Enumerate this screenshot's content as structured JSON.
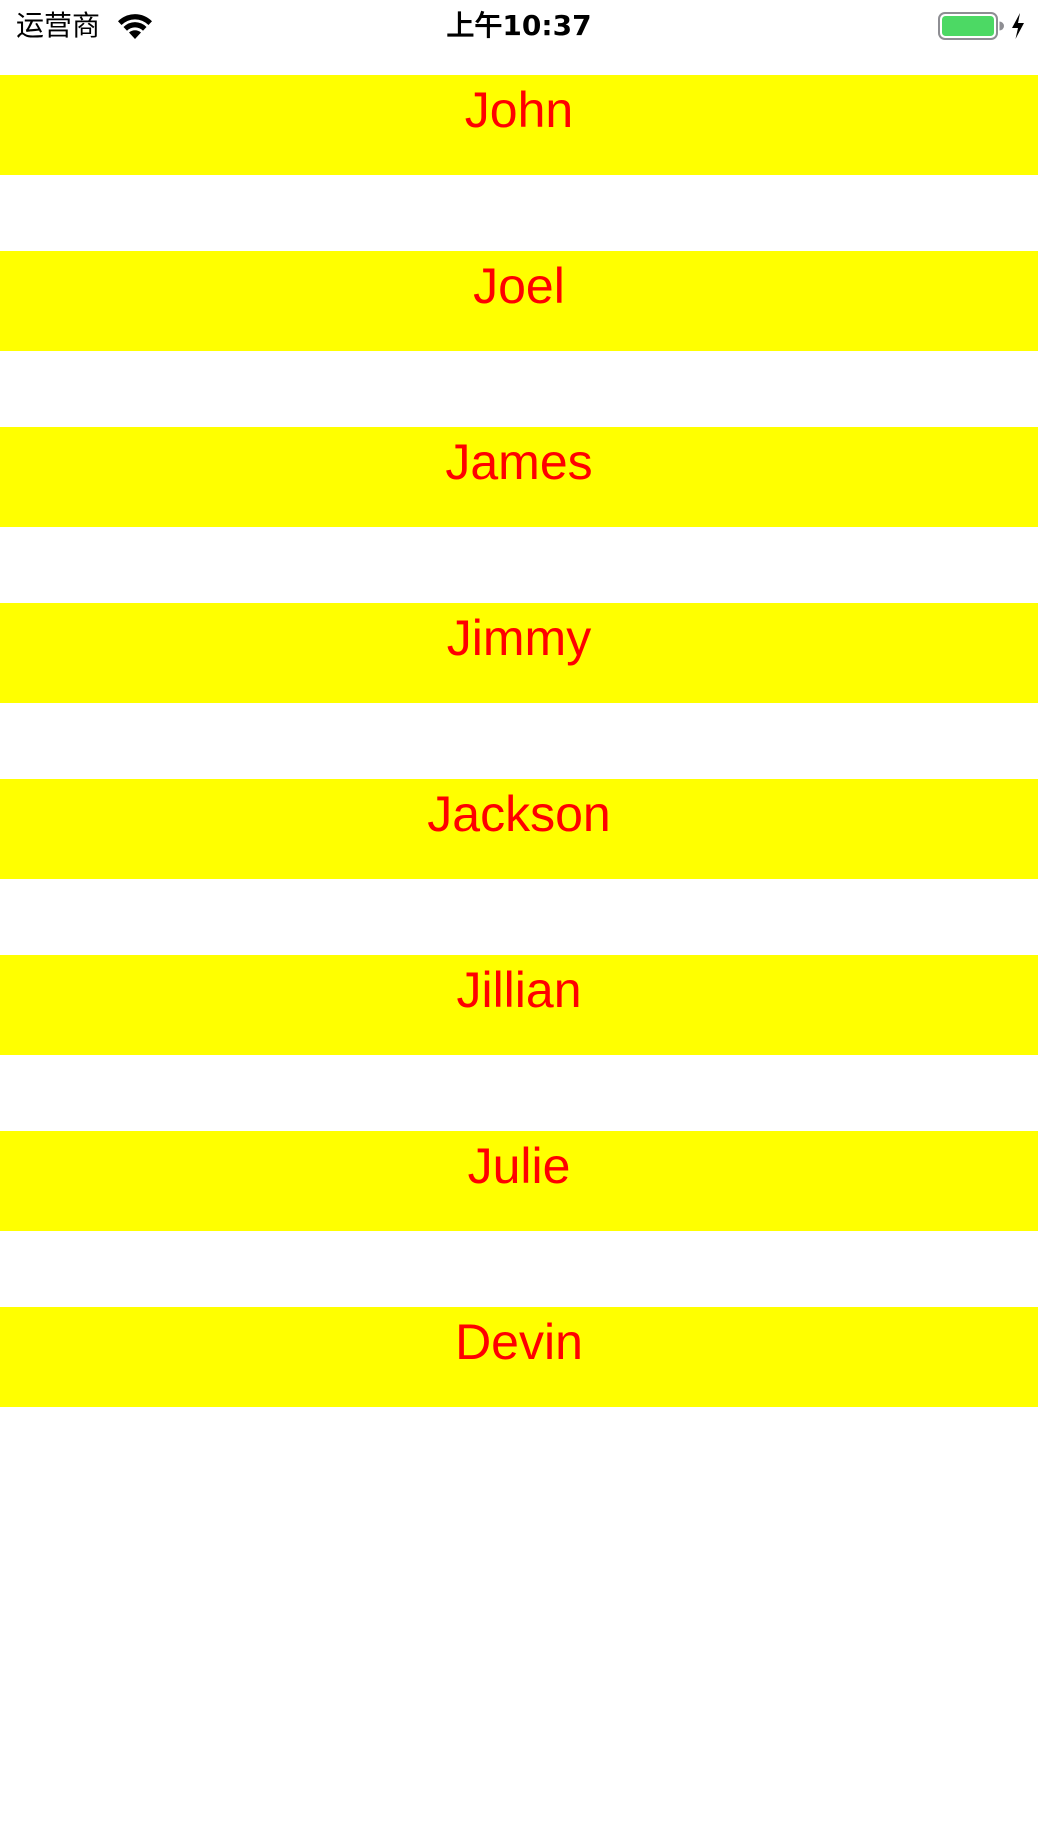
{
  "status_bar": {
    "carrier": "运营商",
    "time": "上午10:37",
    "wifi_icon": "wifi-icon",
    "battery_icon": "battery-icon",
    "charging_icon": "charging-bolt-icon",
    "battery_level": 1.0,
    "battery_color": "#4cd964"
  },
  "colors": {
    "row_background": "#ffff00",
    "row_text": "#ff0000",
    "page_background": "#ffffff"
  },
  "names": [
    {
      "label": "John"
    },
    {
      "label": "Joel"
    },
    {
      "label": "James"
    },
    {
      "label": "Jimmy"
    },
    {
      "label": "Jackson"
    },
    {
      "label": "Jillian"
    },
    {
      "label": "Julie"
    },
    {
      "label": "Devin"
    }
  ]
}
